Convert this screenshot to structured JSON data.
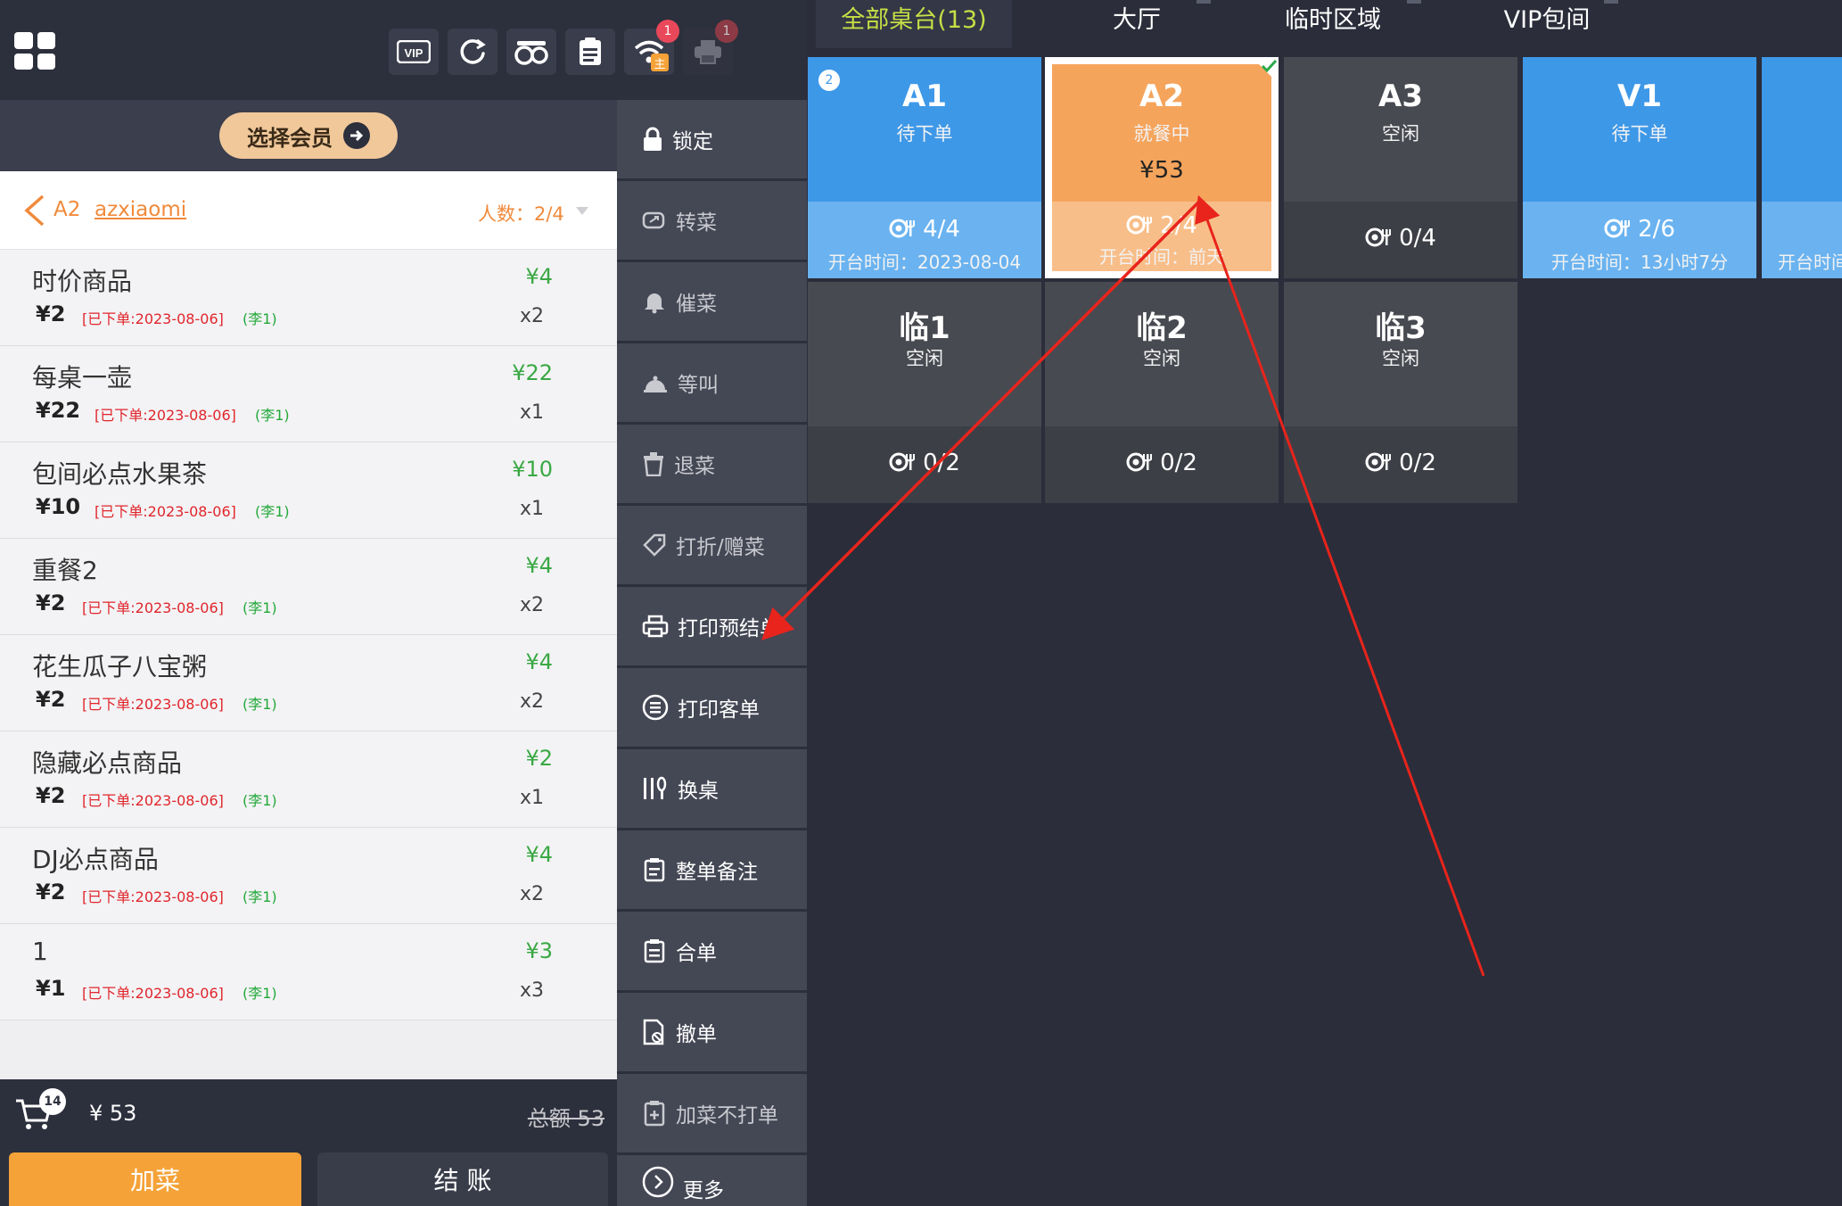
{
  "colors": {
    "accent_orange": "#f5a238",
    "table_blue": "#3e98e8",
    "table_dining": "#f5a45c",
    "table_idle": "#484a51",
    "price_green": "#3aa844",
    "status_red": "#e0262c",
    "active_tab": "#c6df45",
    "annotation_arrow": "#e8241c"
  },
  "toolbar": {
    "apps_icon": "apps-grid-icon",
    "buttons": [
      {
        "icon": "vip-icon",
        "text": "VIP"
      },
      {
        "icon": "refresh-icon"
      },
      {
        "icon": "cooking-pot-icon"
      },
      {
        "icon": "clipboard-list-icon"
      },
      {
        "icon": "wifi-icon",
        "badge": "1",
        "sub_label": "主"
      },
      {
        "icon": "printer-icon",
        "badge": "1"
      }
    ]
  },
  "member": {
    "select_label": "选择会员"
  },
  "order": {
    "table": "A2",
    "user": "azxiaomi",
    "people": "人数：2/4",
    "items": [
      {
        "name": "时价商品",
        "unit_price": "¥2",
        "status": "[已下单:2023-08-06]",
        "user": "(李1)",
        "total": "¥4",
        "qty": "x2"
      },
      {
        "name": "每桌一壶",
        "unit_price": "¥22",
        "status": "[已下单:2023-08-06]",
        "user": "(李1)",
        "total": "¥22",
        "qty": "x1"
      },
      {
        "name": "包间必点水果茶",
        "unit_price": "¥10",
        "status": "[已下单:2023-08-06]",
        "user": "(李1)",
        "total": "¥10",
        "qty": "x1"
      },
      {
        "name": "重餐2",
        "unit_price": "¥2",
        "status": "[已下单:2023-08-06]",
        "user": "(李1)",
        "total": "¥4",
        "qty": "x2"
      },
      {
        "name": "花生瓜子八宝粥",
        "unit_price": "¥2",
        "status": "[已下单:2023-08-06]",
        "user": "(李1)",
        "total": "¥4",
        "qty": "x2"
      },
      {
        "name": "隐藏必点商品",
        "unit_price": "¥2",
        "status": "[已下单:2023-08-06]",
        "user": "(李1)",
        "total": "¥2",
        "qty": "x1"
      },
      {
        "name": "DJ必点商品",
        "unit_price": "¥2",
        "status": "[已下单:2023-08-06]",
        "user": "(李1)",
        "total": "¥4",
        "qty": "x2"
      },
      {
        "name": "1",
        "unit_price": "¥1",
        "status": "[已下单:2023-08-06]",
        "user": "(李1)",
        "total": "¥3",
        "qty": "x3"
      }
    ]
  },
  "cart": {
    "badge": "14",
    "amount": "¥ 53",
    "total": "总额 53"
  },
  "bottom": {
    "add_label": "加菜",
    "pay_label": "结 账"
  },
  "actions": [
    {
      "label": "锁定",
      "icon": "lock-icon"
    },
    {
      "label": "转菜",
      "icon": "transfer-dish-icon"
    },
    {
      "label": "催菜",
      "icon": "bell-icon"
    },
    {
      "label": "等叫",
      "icon": "hand-bell-icon"
    },
    {
      "label": "退菜",
      "icon": "trash-icon"
    },
    {
      "label": "打折/赠菜",
      "icon": "tag-icon"
    },
    {
      "label": "打印预结单",
      "icon": "printer-icon"
    },
    {
      "label": "打印客单",
      "icon": "list-circle-icon"
    },
    {
      "label": "换桌",
      "icon": "utensils-icon"
    },
    {
      "label": "整单备注",
      "icon": "note-icon"
    },
    {
      "label": "合单",
      "icon": "merge-icon"
    },
    {
      "label": "撤单",
      "icon": "cancel-doc-icon"
    },
    {
      "label": "加菜不打单",
      "icon": "clipboard-add-icon"
    },
    {
      "label": "更多",
      "icon": "chevron-circle-icon"
    }
  ],
  "tabs": [
    {
      "label": "全部桌台(13)",
      "active": true
    },
    {
      "label": "大厅"
    },
    {
      "label": "临时区域"
    },
    {
      "label": "VIP包间"
    }
  ],
  "tables": [
    {
      "code": "A1",
      "state": "待下单",
      "seats": "4/4",
      "open_time": "开台时间：2023-08-04",
      "guests": "2",
      "style": "blue"
    },
    {
      "code": "A2",
      "state": "就餐中",
      "amount": "¥53",
      "seats": "2/4",
      "open_time": "开台时间：前天",
      "style": "orange",
      "selected": true
    },
    {
      "code": "A3",
      "state": "空闲",
      "seats": "0/4",
      "style": "grey"
    },
    {
      "code": "V1",
      "state": "待下单",
      "seats": "2/6",
      "open_time": "开台时间：13小时7分",
      "style": "blue"
    },
    {
      "code": "",
      "state": "",
      "open_time": "开台时间",
      "style": "blue",
      "partial": true
    },
    {
      "code": "临1",
      "state": "空闲",
      "seats": "0/2",
      "style": "grey"
    },
    {
      "code": "临2",
      "state": "空闲",
      "seats": "0/2",
      "style": "grey"
    },
    {
      "code": "临3",
      "state": "空闲",
      "seats": "0/2",
      "style": "grey"
    }
  ]
}
